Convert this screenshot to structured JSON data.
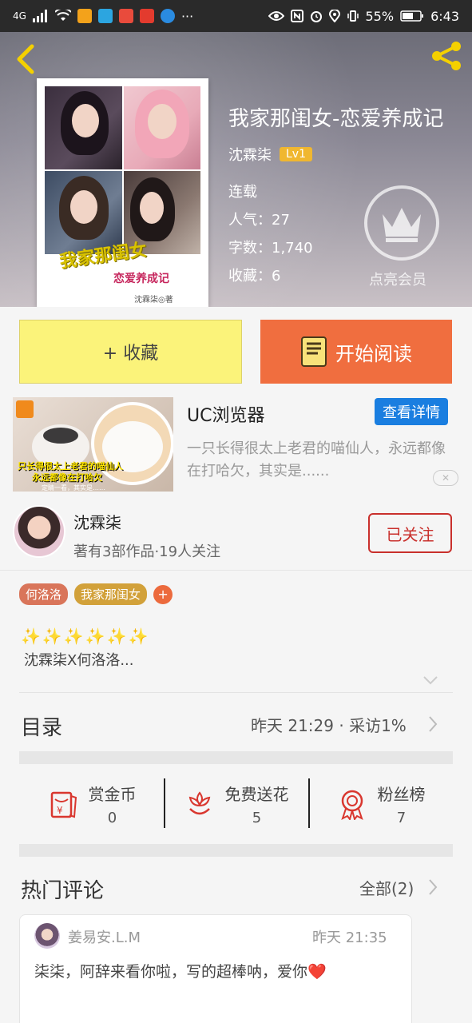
{
  "status_bar": {
    "network": "4G",
    "battery": "55%",
    "time": "6:43",
    "more": "···"
  },
  "book": {
    "title": "我家那闺女-恋爱养成记",
    "author": "沈霖柒",
    "level": "Lv1",
    "status": "连载",
    "popularity": "人气：27",
    "word_count": "字数：1,740",
    "favorites": "收藏：6",
    "vip_label": "点亮会员",
    "cover": {
      "title": "我家那闺女",
      "subtitle": "恋爱养成记",
      "author": "沈霖柒◎著"
    }
  },
  "actions": {
    "favorite": "+ 收藏",
    "read": "开始阅读"
  },
  "ad": {
    "title": "UC浏览器",
    "button": "查看详情",
    "description": "一只长得很太上老君的喵仙人，永远都像在打哈欠，其实是......",
    "caption_line1": "只长得很太上老君的喵仙人",
    "caption_line2": "永远都像在打哈欠",
    "caption_line3": "定睛一看，其实是……"
  },
  "author_block": {
    "name": "沈霖柒",
    "stats": "著有3部作品·19人关注",
    "follow": "已关注"
  },
  "tags": [
    {
      "label": "何洛洛",
      "color": "#d9755a"
    },
    {
      "label": "我家那闺女",
      "color": "#d2a13a"
    }
  ],
  "intro": {
    "sparkles": "✨✨✨✨✨✨",
    "text": "沈霖柒X何洛洛..."
  },
  "catalog": {
    "title": "目录",
    "info": "昨天 21:29 · 采访1%"
  },
  "stats": [
    {
      "label": "赏金币",
      "value": "0",
      "icon": "red-envelope-icon"
    },
    {
      "label": "免费送花",
      "value": "5",
      "icon": "flower-icon"
    },
    {
      "label": "粉丝榜",
      "value": "7",
      "icon": "medal-icon"
    }
  ],
  "comments": {
    "title": "热门评论",
    "all": "全部(2)",
    "items": [
      {
        "user": "姜易安.L.M",
        "time": "昨天 21:35",
        "text": "柒柒，阿辞来看你啦，写的超棒呐，爱你❤️"
      }
    ]
  },
  "colors": {
    "accent_orange": "#f06e3f",
    "favorite_yellow": "#fbf37a",
    "follow_red": "#c9302c",
    "ad_blue": "#1a7ee0",
    "level_gold": "#f0b730"
  }
}
